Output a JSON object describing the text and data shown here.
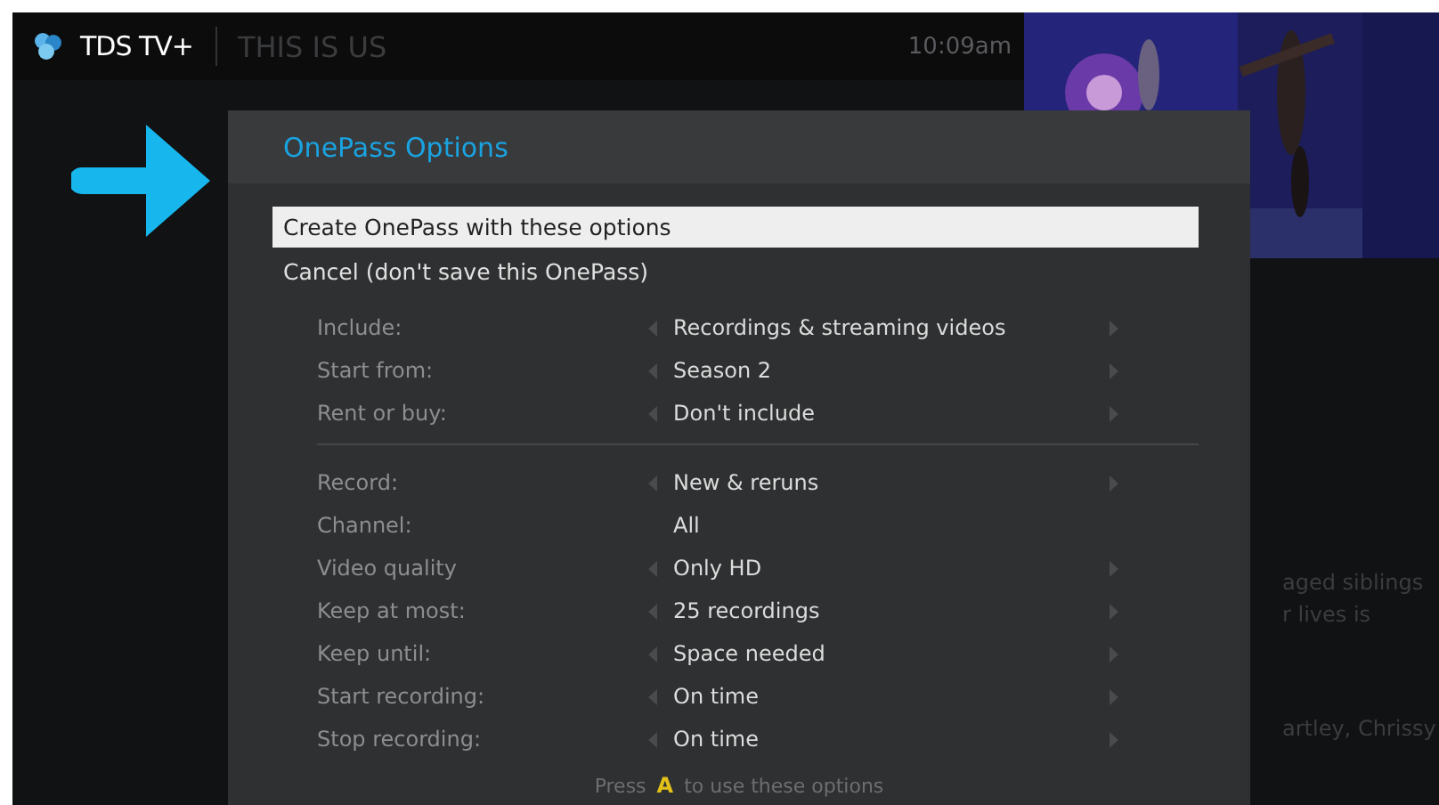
{
  "header": {
    "brand": "TDS TV+",
    "show_title": "THIS IS US",
    "time": "10:09am"
  },
  "background_text": [
    "aged siblings",
    "r lives is",
    "artley, Chrissy"
  ],
  "dialog": {
    "title": "OnePass Options",
    "actions": [
      {
        "label": "Create OnePass with these options",
        "selected": true
      },
      {
        "label": "Cancel (don't save this OnePass)",
        "selected": false
      }
    ],
    "groups": [
      [
        {
          "label": "Include:",
          "value": "Recordings & streaming videos",
          "arrows": true
        },
        {
          "label": "Start from:",
          "value": "Season 2",
          "arrows": true
        },
        {
          "label": "Rent or buy:",
          "value": "Don't include",
          "arrows": true
        }
      ],
      [
        {
          "label": "Record:",
          "value": "New & reruns",
          "arrows": true
        },
        {
          "label": "Channel:",
          "value": "All",
          "arrows": false
        },
        {
          "label": "Video quality",
          "value": "Only HD",
          "arrows": true
        },
        {
          "label": "Keep at most:",
          "value": "25 recordings",
          "arrows": true
        },
        {
          "label": "Keep until:",
          "value": "Space needed",
          "arrows": true
        },
        {
          "label": "Start recording:",
          "value": "On time",
          "arrows": true
        },
        {
          "label": "Stop recording:",
          "value": "On time",
          "arrows": true
        }
      ]
    ],
    "footer": {
      "before": "Press",
      "key": "A",
      "after": "to use these options"
    }
  }
}
